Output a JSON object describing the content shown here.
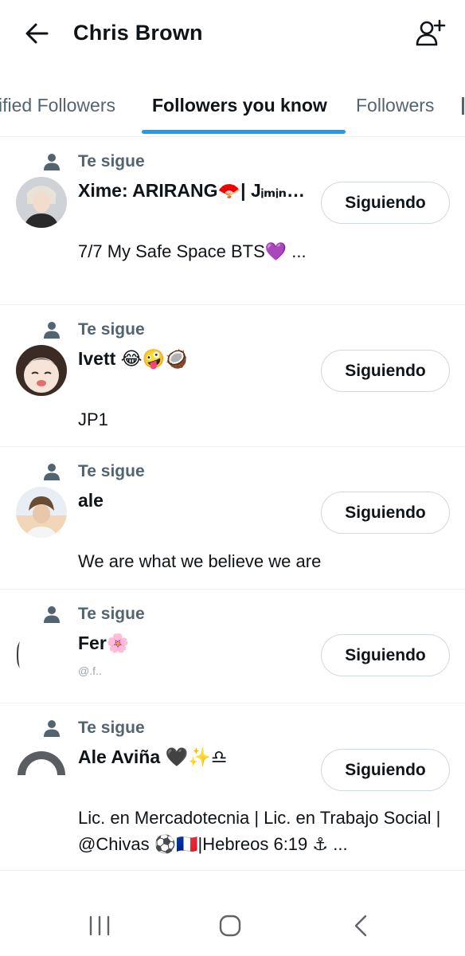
{
  "header": {
    "title": "Chris Brown"
  },
  "tabs": [
    {
      "label": "ified Followers"
    },
    {
      "label": "Followers you know"
    },
    {
      "label": "Followers"
    }
  ],
  "context_label": "Te sigue",
  "follow_button_label": "Siguiendo",
  "users": [
    {
      "name": "Xime: ARIRANG🪭| Jᵢₘᵢₙ…",
      "handle": "",
      "bio": "7/7 My Safe Space BTS💜 ..."
    },
    {
      "name": "Ivett 😂🤪🥥",
      "handle": "",
      "bio": "JP1"
    },
    {
      "name": "ale",
      "handle": "",
      "bio": "We are what we believe we are"
    },
    {
      "name": "Fer🌸",
      "handle": "@.f..",
      "bio": ""
    },
    {
      "name": "Ale Aviña 🖤✨♎",
      "handle": "",
      "bio": "Lic. en Mercadotecnia | Lic. en Trabajo Social | @Chivas ⚽🇫🇷|Hebreos 6:19 ⚓ ..."
    }
  ],
  "colors": {
    "accent": "#1d9bf0",
    "secondary_text": "#536471",
    "primary_text": "#0f1419",
    "border": "#cfd9de"
  },
  "icons": {
    "back": "arrow-left-icon",
    "add_user": "add-user-icon",
    "context": "person-icon",
    "nav_recents": "recents-icon",
    "nav_home": "home-icon",
    "nav_back": "nav-back-icon"
  }
}
